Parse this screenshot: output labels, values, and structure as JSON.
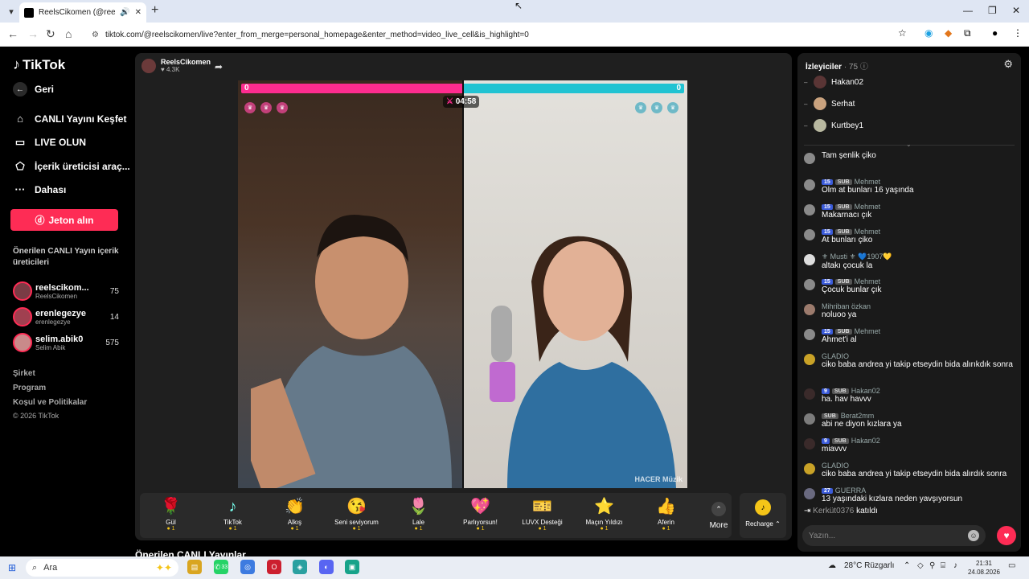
{
  "browser": {
    "tab_title": "ReelsCikomen (@reelscikomen",
    "url": "tiktok.com/@reelscikomen/live?enter_from_merge=personal_homepage&enter_method=video_live_cell&is_highlight=0"
  },
  "sidebar": {
    "logo": "TikTok",
    "back_label": "Geri",
    "nav": [
      {
        "label": "CANLI Yayını Keşfet",
        "icon": "compass-icon"
      },
      {
        "label": "LIVE OLUN",
        "icon": "camera-icon"
      },
      {
        "label": "İçerik üreticisi araç...",
        "icon": "creator-tools-icon"
      },
      {
        "label": "Dahası",
        "icon": "more-dots-icon"
      }
    ],
    "jeton_label": "Jeton alın",
    "suggested_title": "Önerilen CANLI Yayın içerik üreticileri",
    "creators": [
      {
        "name": "reelscikom...",
        "sub": "ReelsCikomen",
        "count": "75"
      },
      {
        "name": "erenlegezye",
        "sub": "erenlegezye",
        "count": "14"
      },
      {
        "name": "selim.abik0",
        "sub": "Selim Abik",
        "count": "575"
      }
    ],
    "footer": [
      "Şirket",
      "Program",
      "Koşul ve Politikalar",
      "© 2026 TikTok"
    ]
  },
  "live": {
    "host_name": "ReelsCikomen",
    "host_likes": "♥ 4.3K",
    "score_left": "0",
    "score_right": "0",
    "timer": "04:58",
    "watermark": "HACER Müzik"
  },
  "gifts": [
    {
      "name": "Gül",
      "cost": "1",
      "icon": "🌹"
    },
    {
      "name": "TikTok",
      "cost": "1",
      "icon": "♪"
    },
    {
      "name": "Alkış",
      "cost": "1",
      "icon": "👏"
    },
    {
      "name": "Seni seviyorum",
      "cost": "1",
      "icon": "😘"
    },
    {
      "name": "Lale",
      "cost": "1",
      "icon": "🌷"
    },
    {
      "name": "Parlıyorsun!",
      "cost": "1",
      "icon": "💖"
    },
    {
      "name": "LUVX Desteği",
      "cost": "1",
      "icon": "🎫"
    },
    {
      "name": "Maçın Yıldızı",
      "cost": "1",
      "icon": "⭐"
    },
    {
      "name": "Aferin",
      "cost": "1",
      "icon": "👍"
    }
  ],
  "more_label": "More",
  "recharge_label": "Recharge ⌃",
  "suggested_lives": "Önerilen CANLI Yayınlar",
  "chat": {
    "viewers_label": "İzleyiciler",
    "viewers_count": "· 75",
    "top_viewers": [
      "Hakan02",
      "Serhat",
      "Kurtbey1"
    ],
    "messages": [
      {
        "level": "",
        "sub": "",
        "user": "",
        "text": "Tam şenlik çiko"
      },
      {
        "level": "15",
        "sub": "SUB",
        "user": "Mehmet",
        "text": "Olm at bunları 16 yaşında"
      },
      {
        "level": "15",
        "sub": "SUB",
        "user": "Mehmet",
        "text": "Makarnacı çık"
      },
      {
        "level": "15",
        "sub": "SUB",
        "user": "Mehmet",
        "text": "At bunları çiko"
      },
      {
        "level": "",
        "sub": "",
        "user": "⚜ Musti ⚜ 💙1907💛",
        "text": "altakı çocuk la"
      },
      {
        "level": "15",
        "sub": "SUB",
        "user": "Mehmet",
        "text": "Çocuk bunlar çık"
      },
      {
        "level": "",
        "sub": "",
        "user": "Mihriban özkan",
        "text": "noluoo ya"
      },
      {
        "level": "15",
        "sub": "SUB",
        "user": "Mehmet",
        "text": "Ahmet'i al"
      },
      {
        "level": "",
        "sub": "",
        "user": "GLADIO",
        "text": "ciko baba andrea yi takip etseydin bida alırıkdık sonra"
      },
      {
        "level": "9",
        "sub": "SUB",
        "user": "Hakan02",
        "text": "ha. hav havvv"
      },
      {
        "level": "",
        "sub": "SUB",
        "user": "Berat2mm",
        "text": "abi ne diyon kızlara ya"
      },
      {
        "level": "9",
        "sub": "SUB",
        "user": "Hakan02",
        "text": "miavvv"
      },
      {
        "level": "",
        "sub": "",
        "user": "GLADIO",
        "text": "ciko baba andrea yi takip etseydin bida alırdık sonra"
      },
      {
        "level": "27",
        "sub": "",
        "user": "GUERRA",
        "text": "13 yaşındaki kızlara neden yavşıyorsun"
      }
    ],
    "joined_user": "Kerküt0376",
    "joined_text": "katıldı",
    "input_placeholder": "Yazın..."
  },
  "taskbar": {
    "search_label": "Ara",
    "whatsapp_badge": "33",
    "weather": "28°C  Rüzgarlı",
    "time": "21:31",
    "date": "24.08.2026"
  }
}
